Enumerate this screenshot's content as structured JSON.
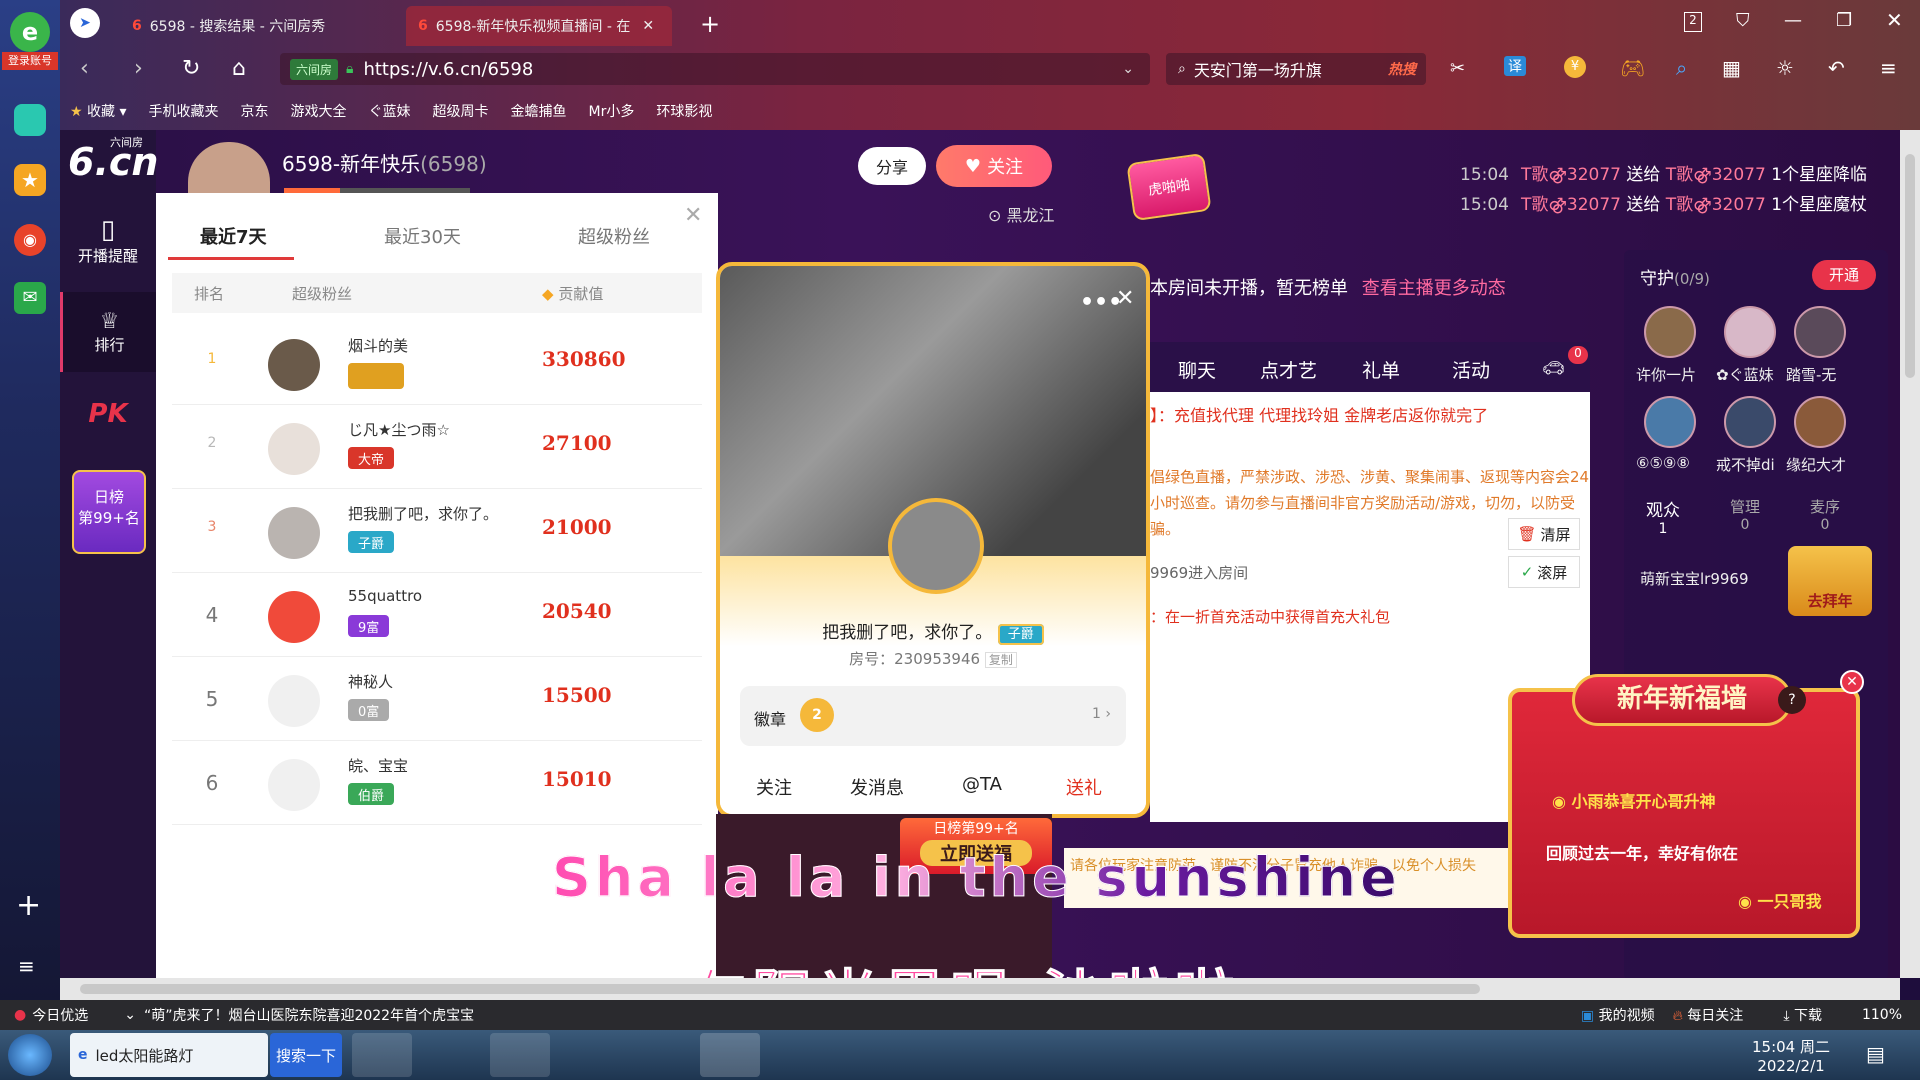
{
  "browser": {
    "login_label": "登录账号",
    "tabs": [
      {
        "label": "6598 - 搜索结果 - 六间房秀"
      },
      {
        "label": "6598-新年快乐视频直播间 - 在"
      }
    ],
    "address": "https://v.6.cn/6598",
    "site_badge": "六间房",
    "search_text": "天安门第一场升旗",
    "search_hot": "热搜",
    "translate_label": "译",
    "tab_count": "2",
    "bookmarks": [
      "收藏",
      "手机收藏夹",
      "京东",
      "游戏大全",
      "ぐ蓝妹",
      "超级周卡",
      "金蟾捕鱼",
      "Mr小多",
      "环球影视"
    ]
  },
  "site": {
    "logo_main": "6.cn",
    "logo_sub": "六间房",
    "nav": [
      {
        "label": "开播提醒"
      },
      {
        "label": "排行"
      },
      {
        "label": "PK"
      }
    ],
    "daily_rank": {
      "title": "日榜",
      "value": "第99+名"
    }
  },
  "room": {
    "anchor_name": "6598-新年快乐",
    "room_id": "(6598)",
    "share_label": "分享",
    "follow_label": "关注",
    "location": "黑龙江",
    "hot_badge": "虎啪啪"
  },
  "rank_panel": {
    "tabs": [
      "最近7天",
      "最近30天",
      "超级粉丝"
    ],
    "headers": {
      "rank": "排名",
      "fan": "超级粉丝",
      "value": "贡献值"
    },
    "rows": [
      {
        "rank": "1",
        "name": "烟斗的美",
        "badge": "",
        "value": "330860"
      },
      {
        "rank": "2",
        "name": "じ凡★尘つ雨☆",
        "badge": "大帝",
        "value": "27100"
      },
      {
        "rank": "3",
        "name": "把我删了吧，求你了。",
        "badge": "子爵",
        "value": "21000"
      },
      {
        "rank": "4",
        "name": "55quattro",
        "badge": "9富",
        "value": "20540"
      },
      {
        "rank": "5",
        "name": "神秘人",
        "badge": "0富",
        "value": "15500"
      },
      {
        "rank": "6",
        "name": "皖、宝宝",
        "badge": "伯爵",
        "value": "15010"
      }
    ],
    "badge_colors": [
      "#e0a020",
      "#d9362a",
      "#2aa8c8",
      "#8a3ad8",
      "#aaaaaa",
      "#3aa858"
    ]
  },
  "profile_card": {
    "name": "把我删了吧，求你了。",
    "title_badge": "子爵",
    "room_label": "房号：230953946",
    "copy_label": "复制",
    "medal_label": "徽章",
    "medal_count": "1",
    "medal_level": "2",
    "actions": [
      "关注",
      "发消息",
      "@TA",
      "送礼"
    ]
  },
  "chat": {
    "tip": "本房间未开播，暂无榜单",
    "tip_link": "查看主播更多动态",
    "tabs": [
      "聊天",
      "点才艺",
      "礼单",
      "活动"
    ],
    "car_badge": "0",
    "notice": "】：充值找代理 代理找玲姐 金牌老店返你就完了",
    "rules": "倡绿色直播，严禁涉政、涉恐、涉黄、聚集闹事、返现等内容会24小时巡查。请勿参与直播间非官方奖励活动/游戏，切勿，以防受骗。",
    "clear_label": "清屏",
    "scroll_label": "滚屏",
    "enter_msg": "9969进入房间",
    "gift_msg": "：在一折首充活动中获得首充大礼包",
    "bottom_notice": "请各位玩家注意防范，谨防不法分子冒充他人诈骗，以免个人损失",
    "daily_rank": "日榜第99+名",
    "send_gift": "立即送福"
  },
  "guard": {
    "title": "守护",
    "count": "(0/9)",
    "open_label": "开通",
    "members": [
      "许你一片",
      "✿ぐ蓝妹",
      "踏雪-无",
      "⑥⑤⑨⑧",
      "戒不掉di",
      "缘纪大才"
    ],
    "tabs": [
      {
        "label": "观众",
        "count": "1"
      },
      {
        "label": "管理",
        "count": "0"
      },
      {
        "label": "麦序",
        "count": "0"
      }
    ],
    "audience": "萌新宝宝lr9969",
    "worship": "去拜年"
  },
  "messages": [
    {
      "time": "15:04",
      "from": "T歌⚣32077",
      "verb": "送给",
      "to": "T歌⚣32077",
      "gift": "1个星座降临"
    },
    {
      "time": "15:04",
      "from": "T歌⚣32077",
      "verb": "送给",
      "to": "T歌⚣32077",
      "gift": "1个星座魔杖"
    }
  ],
  "ny_popup": {
    "title": "新年新福墙",
    "user": "小雨恭喜开心哥升神",
    "wish": "回顾过去一年，幸好有你在",
    "footer": "一只哥我"
  },
  "subtitles": {
    "english": "Sha  la  la  in the sunshine",
    "chinese": "在阳光里唱  沙啦啦"
  },
  "statusbar": {
    "left": "今日优选",
    "news": "“萌”虎来了！烟台山医院东院喜迎2022年首个虎宝宝",
    "my_video": "我的视频",
    "daily_follow": "每日关注",
    "download": "下载",
    "zoom": "110%"
  },
  "taskbar": {
    "app1": "led太阳能路灯",
    "app1_btn": "搜索一下",
    "time": "15:04 周二",
    "date": "2022/2/1"
  }
}
